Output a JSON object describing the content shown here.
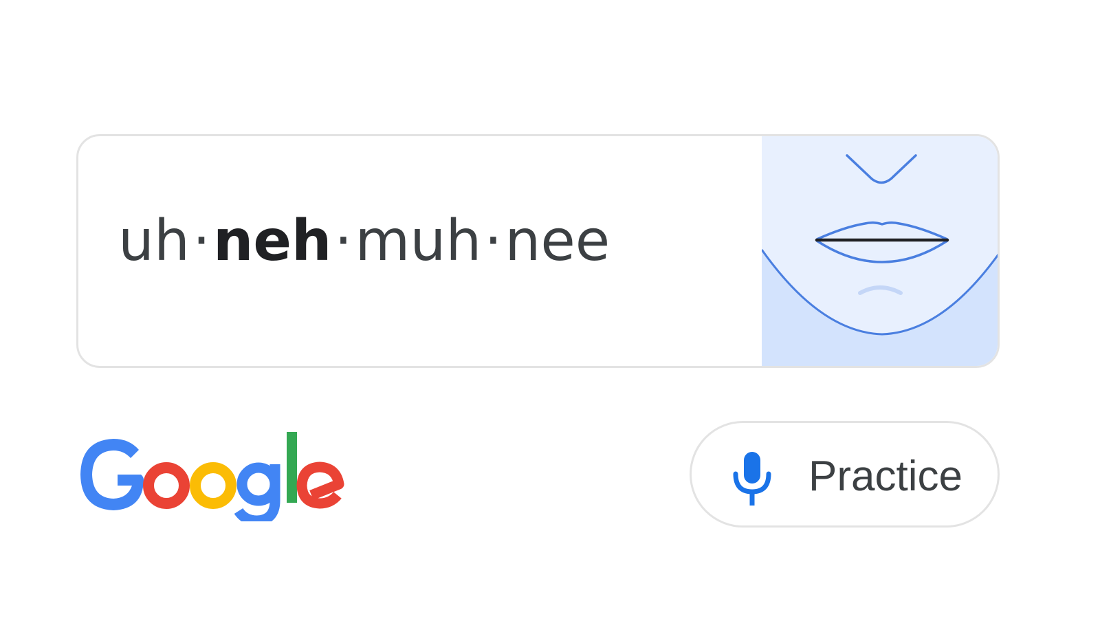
{
  "pronunciation": {
    "syllables": [
      {
        "text": "uh",
        "stressed": false
      },
      {
        "text": "neh",
        "stressed": true
      },
      {
        "text": "muh",
        "stressed": false
      },
      {
        "text": "nee",
        "stressed": false
      }
    ],
    "separator": "·"
  },
  "mouth_illustration": {
    "icon": "mouth-shape-icon",
    "panel_color": "#e8f0fe",
    "line_color": "#4a7fe0"
  },
  "logo": {
    "text": "Google",
    "icon": "google-logo",
    "colors": [
      "#4285f4",
      "#ea4335",
      "#fbbc05",
      "#4285f4",
      "#34a853",
      "#ea4335"
    ]
  },
  "practice_button": {
    "label": "Practice",
    "icon": "microphone-icon",
    "icon_color": "#1a73e8"
  }
}
